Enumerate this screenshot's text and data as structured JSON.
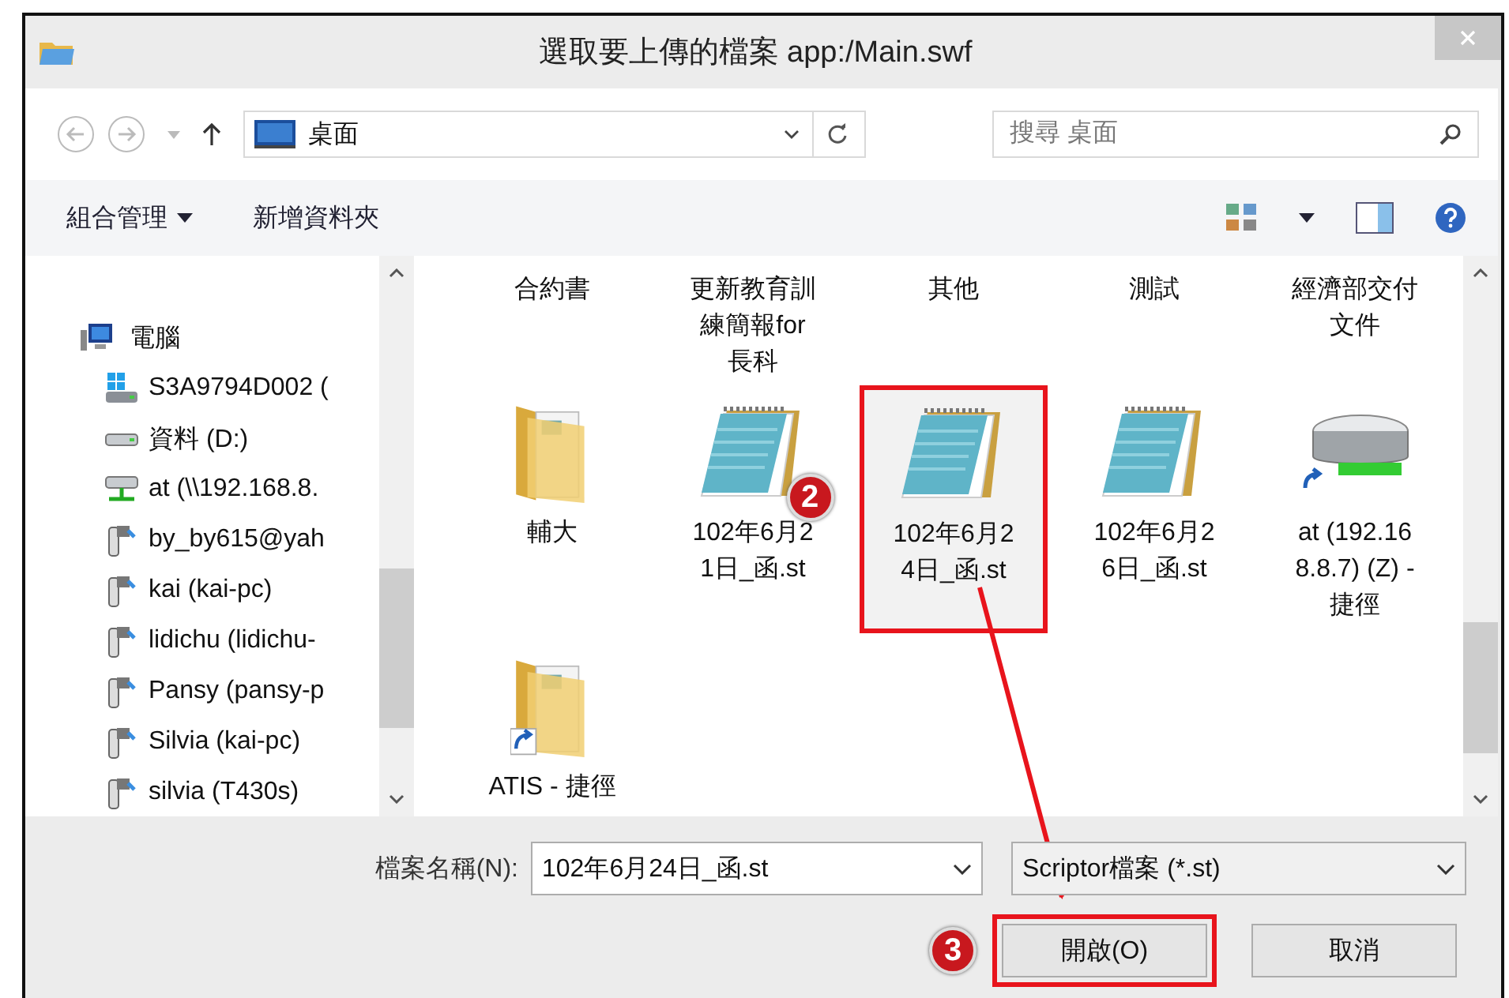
{
  "window": {
    "title": "選取要上傳的檔案 app:/Main.swf"
  },
  "nav": {
    "location": "桌面",
    "search_placeholder": "搜尋 桌面"
  },
  "toolbar": {
    "organize": "組合管理",
    "new_folder": "新增資料夾"
  },
  "sidebar": {
    "items": [
      {
        "label": "電腦",
        "kind": "computer",
        "children": [
          {
            "label": "S3A9794D002 (",
            "kind": "system-drive"
          },
          {
            "label": "資料 (D:)",
            "kind": "drive"
          },
          {
            "label": "at (\\\\192.168.8.",
            "kind": "network-drive"
          },
          {
            "label": "by_by615@yah",
            "kind": "media"
          },
          {
            "label": "kai (kai-pc)",
            "kind": "media"
          },
          {
            "label": "lidichu (lidichu-",
            "kind": "media"
          },
          {
            "label": "Pansy (pansy-p",
            "kind": "media"
          },
          {
            "label": "Silvia (kai-pc)",
            "kind": "media"
          },
          {
            "label": "silvia (T430s)",
            "kind": "media"
          }
        ]
      }
    ]
  },
  "files": [
    {
      "name": "合約書",
      "kind": "cut",
      "selected": false,
      "highlighted": false
    },
    {
      "name": "更新教育訓練簡報for長科",
      "kind": "cut",
      "selected": false,
      "highlighted": false
    },
    {
      "name": "其他",
      "kind": "cut",
      "selected": false,
      "highlighted": false
    },
    {
      "name": "測試",
      "kind": "cut",
      "selected": false,
      "highlighted": false
    },
    {
      "name": "經濟部交付文件",
      "kind": "cut",
      "selected": false,
      "highlighted": false
    },
    {
      "name": "輔大",
      "kind": "folder",
      "selected": false,
      "highlighted": false
    },
    {
      "name": "102年6月21日_函.st",
      "kind": "document",
      "selected": false,
      "highlighted": false,
      "callout": "2"
    },
    {
      "name": "102年6月24日_函.st",
      "kind": "document",
      "selected": true,
      "highlighted": true
    },
    {
      "name": "102年6月26日_函.st",
      "kind": "document",
      "selected": false,
      "highlighted": false
    },
    {
      "name": "at (192.168.8.7) (Z) - 捷徑",
      "kind": "drive-shortcut",
      "selected": false,
      "highlighted": false
    },
    {
      "name": "ATIS - 捷徑",
      "kind": "folder-shortcut",
      "selected": false,
      "highlighted": false
    }
  ],
  "footer": {
    "filename_label": "檔案名稱(N):",
    "filename": "102年6月24日_函.st",
    "filter": "Scriptor檔案 (*.st)",
    "buttons": [
      {
        "label": "開啟(O)",
        "highlighted": true,
        "callout": "3"
      },
      {
        "label": "取消",
        "highlighted": false
      }
    ]
  }
}
